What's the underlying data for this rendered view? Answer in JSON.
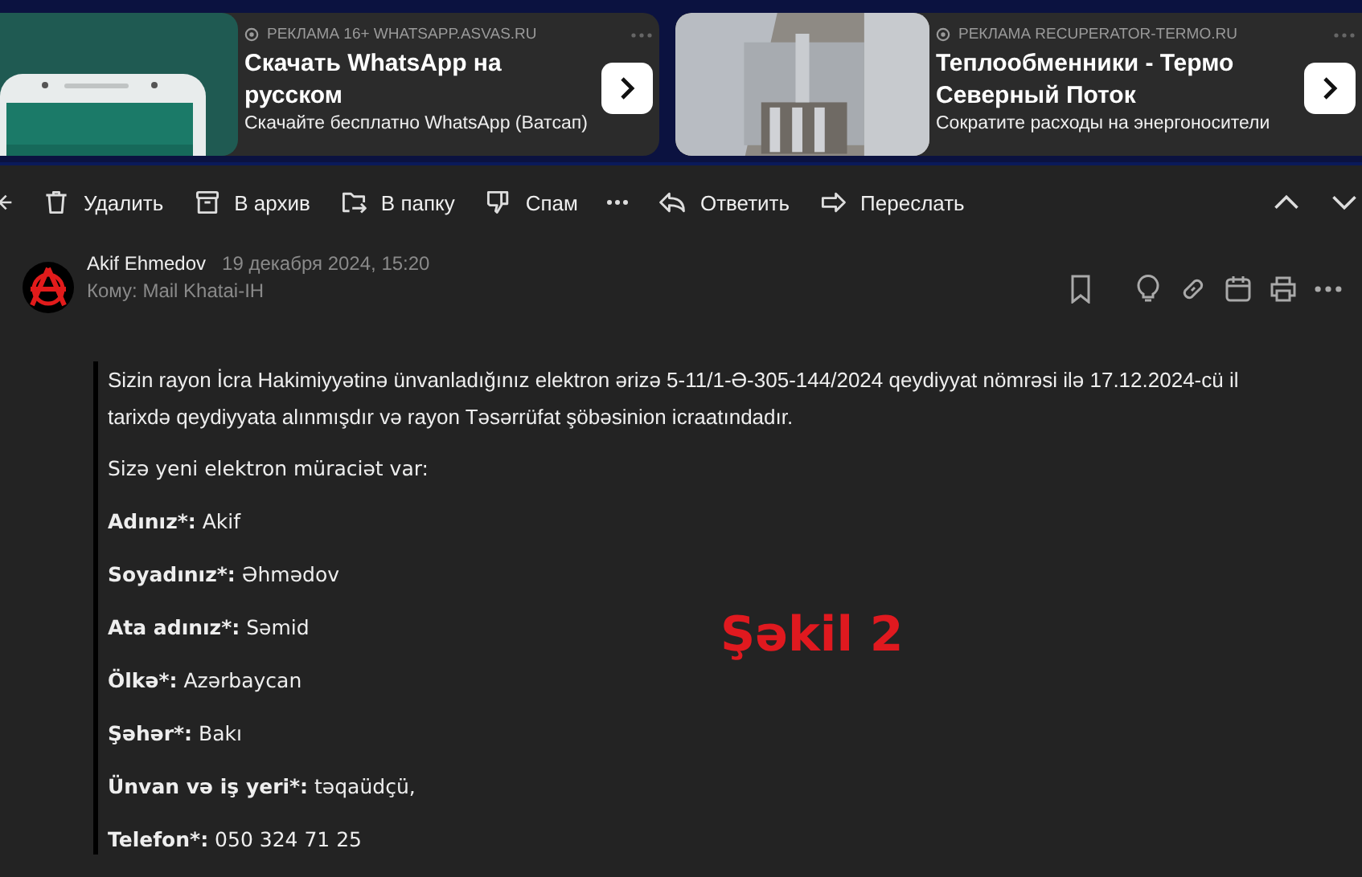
{
  "ads": [
    {
      "label": "РЕКЛАМА 16+ WHATSAPP.ASVAS.RU",
      "title": "Скачать WhatsApp на русском",
      "subtitle": "Скачайте бесплатно WhatsApp (Ватсап)"
    },
    {
      "label": "РЕКЛАМА RECUPERATOR-TERMO.RU",
      "title": "Теплообменники - Термо Северный Поток",
      "subtitle": "Сократите расходы на энергоносители"
    }
  ],
  "toolbar": [
    {
      "kind": "delete",
      "label": "Удалить"
    },
    {
      "kind": "archive",
      "label": "В архив"
    },
    {
      "kind": "move",
      "label": "В папку"
    },
    {
      "kind": "spam",
      "label": "Спам"
    },
    {
      "kind": "more"
    },
    {
      "kind": "reply",
      "label": "Ответить"
    },
    {
      "kind": "forward",
      "label": "Переслать"
    }
  ],
  "message": {
    "sender": "Akif Ehmedov",
    "date": "19 декабря 2024, 15:20",
    "to": "Кому: Mail Khatai-IH",
    "intro": "Sizin rayon İcra Hakimiyyətinə ünvanladığınız elektron ərizə 5-11/1-Ə-305-144/2024 qeydiyyat nömrəsi ilə  17.12.2024-cü il tarixdə qeydiyyata alınmışdır və rayon Təsərrüfat şöbəsinion icraatındadır.",
    "heading": "Sizə yeni elektron müraciət var:",
    "fields": [
      {
        "label": "Adınız*:",
        "value": "Akif"
      },
      {
        "label": "Soyadınız*:",
        "value": "Əhmədov"
      },
      {
        "label": "Ata adınız*:",
        "value": "Səmid"
      },
      {
        "label": "Ölkə*:",
        "value": "Azərbaycan"
      },
      {
        "label": "Şəhər*:",
        "value": "Bakı"
      },
      {
        "label": "Ünvan və iş yeri*:",
        "value": "təqaüdçü,"
      },
      {
        "label": "Telefon*:",
        "value": "050 324 71 25"
      }
    ]
  },
  "annotation": "Şəkil 2"
}
